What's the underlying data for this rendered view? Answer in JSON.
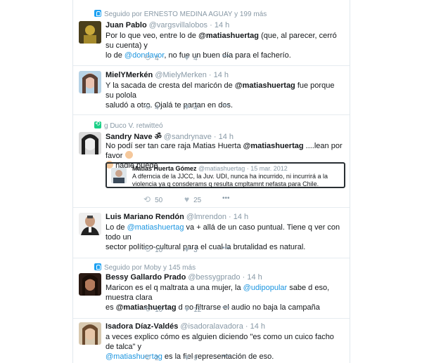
{
  "tweets": [
    {
      "context": "Seguido por ERNESTO MEDINA AGUAY y 199 más",
      "name": "Juan Pablo",
      "handle": "@vargsvillalobos",
      "time": "14 h",
      "text": {
        "p1": "Por lo que veo, entre lo de ",
        "m1": "@matiashuertag",
        "p2": " (que, al parecer, cerró su cuenta) y",
        "p3": "lo de ",
        "m2": "@dondavor",
        "p4": ", no fue un buen día para el facherío."
      },
      "retweets": "4",
      "likes": "4",
      "more": "•••"
    },
    {
      "name": "MielYMerkén",
      "handle": "@MielyMerken",
      "time": "14 h",
      "text": {
        "p1": "Y la sacada de cresta del maricón de ",
        "m1": "@matiashuertag",
        "p2": " fue porque su polola",
        "p3": "saludó a otro. Ojalá te partan en dos."
      },
      "retweets": "4",
      "likes": "4",
      "more": "•••"
    },
    {
      "context": "g Duco V. retwitteó",
      "name": "Sandry Nave ॐ",
      "handle": "@sandrynave",
      "time": "14 h",
      "text": {
        "p1": "No podí  ser tan care raja  Matias Huerta ",
        "m1": "@matiashuertag",
        "p2": " ....lean por favor",
        "p3": "nadie puede"
      },
      "quote": {
        "name": "Matias Huerta Gómez",
        "handle": "@matiashuertag",
        "date": "15 mar. 2012",
        "text": "A dferncia de la JJCC, la Juv. UDI, nunca ha incurrido, ni incurrirá a la violencia ya q consderams q resulta cmpltamnt nefasta para Chile."
      },
      "retweets": "50",
      "likes": "25",
      "more": "•••"
    },
    {
      "name": "Luis Mariano Rendón",
      "handle": "@lmrendon",
      "time": "14 h",
      "text": {
        "p1": "Lo de ",
        "m1": "@matiashuertag",
        "p2": " va + allá de un caso puntual. Tiene q ver con todo un",
        "p3": "sector político-cultural para el cual la brutalidad es natural."
      },
      "retweets": "10",
      "likes": "3",
      "more": "•••"
    },
    {
      "context": "Seguido por Moby y 145 más",
      "name": "Bessy Gallardo Prado",
      "handle": "@bessygprado",
      "time": "14 h",
      "text": {
        "p1": "Maricon es el q maltrata a una mujer, la ",
        "m1": "@udipopular",
        "p2": " sabe d eso, muestra clara",
        "p3": "es ",
        "m2": "@matiashuertag",
        "p4": " d no filtrarse el audio no baja la campaña"
      },
      "retweets": "10",
      "likes": "12",
      "more": "•••"
    },
    {
      "name": "Isadora Díaz-Valdés",
      "handle": "@isadoralavadora",
      "time": "14 h",
      "text": {
        "p1": "a veces explico cómo es alguien diciendo \"es como un cuico facho de talca\" y",
        "m1": "@matiashuertag",
        "p2": " es la fiel representación de eso."
      },
      "retweets": "2",
      "likes": "9",
      "more": "•••"
    }
  ],
  "icons": {
    "retweet": "⟲",
    "like": "♥",
    "reply": "↩"
  },
  "colors": {
    "link": "#1b95e0",
    "muted": "#8899a6",
    "follow_badge": "#1da1f2",
    "retweet_badge": "#19cf86"
  }
}
